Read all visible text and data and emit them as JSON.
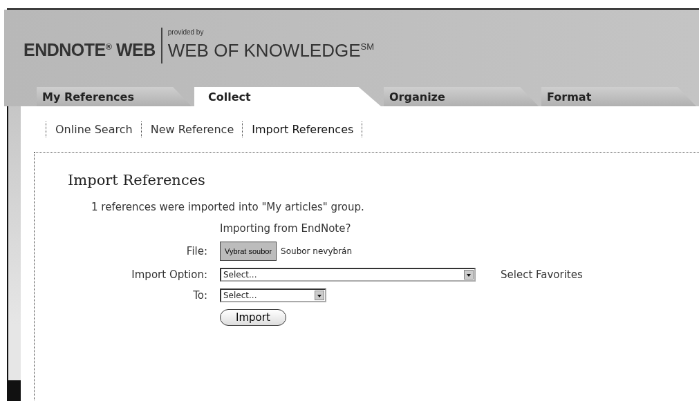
{
  "logo": {
    "product": "ENDNOTE$^{®}$ WEB",
    "provided_by": "provided by",
    "partner": "WEB OF KNOWLEDGE$^{SM}$"
  },
  "tabs": [
    {
      "label": "My References",
      "selected": false
    },
    {
      "label": "Collect",
      "selected": true
    },
    {
      "label": "Organize",
      "selected": false
    },
    {
      "label": "Format",
      "selected": false
    }
  ],
  "subnav": [
    {
      "label": "Online Search",
      "selected": false
    },
    {
      "label": "New Reference",
      "selected": false
    },
    {
      "label": "Import References",
      "selected": true
    }
  ],
  "content": {
    "heading": "Import References",
    "message": "1 references were imported into \"My articles\" group.",
    "endnote_link": "Importing from EndNote?",
    "file": {
      "label": "File:",
      "button": "Vybrat soubor",
      "status": "Soubor nevybrán"
    },
    "import_option": {
      "label": "Import Option:",
      "value": "Select...",
      "link": "Select Favorites"
    },
    "to": {
      "label": "To:",
      "value": "Select..."
    },
    "submit": "Import"
  }
}
